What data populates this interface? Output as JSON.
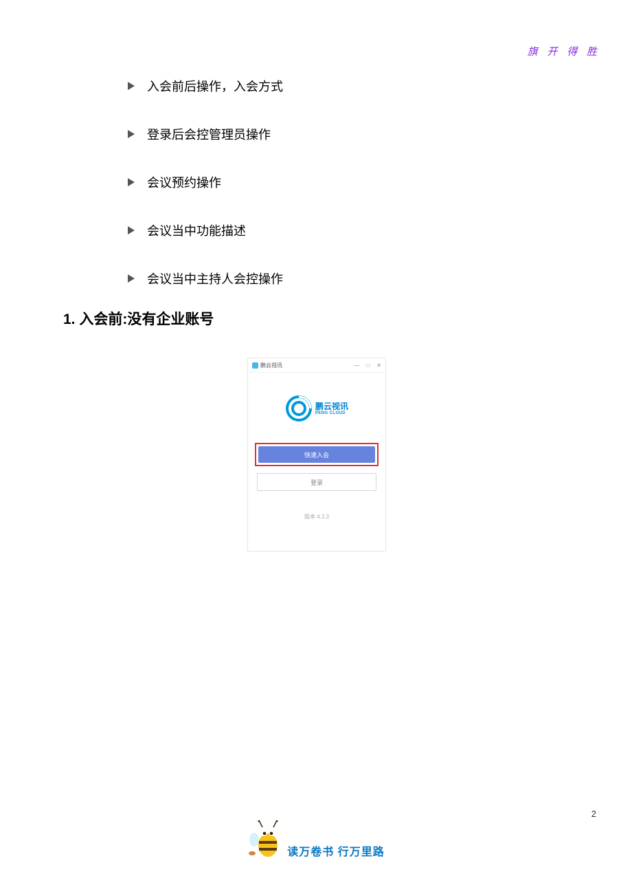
{
  "corner_motto": "旗 开 得 胜",
  "bullets": [
    "入会前后操作，入会方式",
    "登录后会控管理员操作",
    "会议预约操作",
    "会议当中功能描述",
    "会议当中主持人会控操作"
  ],
  "heading1": "1.  入会前:没有企业账号",
  "app": {
    "title": "鹏云视讯",
    "logo_cn": "鹏云视讯",
    "logo_en": "PENG CLOUD",
    "btn_quick": "快速入会",
    "btn_login": "登录",
    "version": "版本 4.2.3",
    "win_min": "—",
    "win_max": "□",
    "win_close": "✕"
  },
  "footer_text": "读万卷书  行万里路",
  "page_number": "2"
}
